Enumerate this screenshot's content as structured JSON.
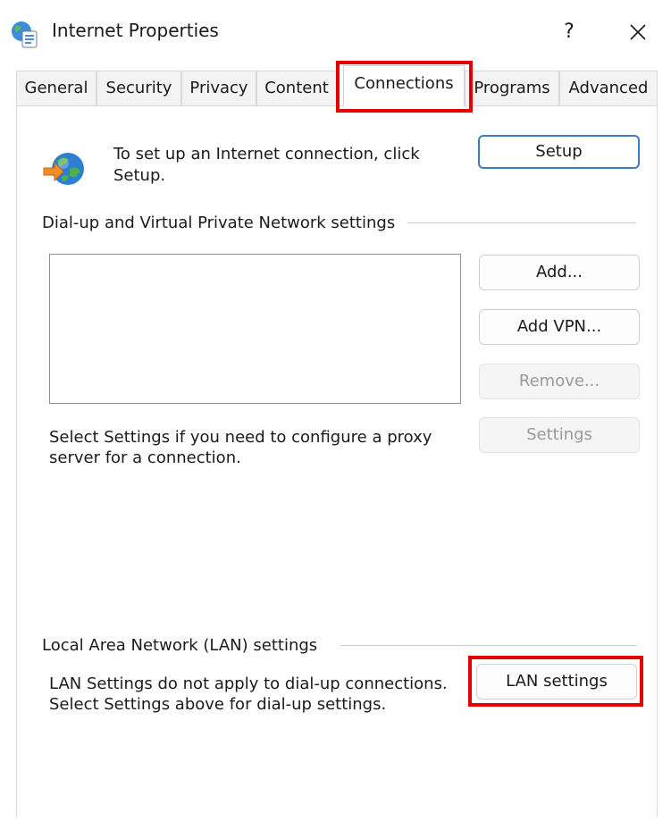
{
  "window": {
    "title": "Internet Properties",
    "help_label": "?",
    "close_icon": "close-icon",
    "app_icon": "internet-properties-icon"
  },
  "tabs": [
    {
      "label": "General",
      "active": false
    },
    {
      "label": "Security",
      "active": false
    },
    {
      "label": "Privacy",
      "active": false
    },
    {
      "label": "Content",
      "active": false
    },
    {
      "label": "Connections",
      "active": true
    },
    {
      "label": "Programs",
      "active": false
    },
    {
      "label": "Advanced",
      "active": false
    }
  ],
  "setup_section": {
    "icon": "globe-connection-icon",
    "text_line1": "To set up an Internet connection, click",
    "text_line2": "Setup.",
    "button": "Setup"
  },
  "dialup_section": {
    "group_label": "Dial-up and Virtual Private Network settings",
    "connections": [],
    "buttons": {
      "add": "Add...",
      "add_vpn": "Add VPN...",
      "remove": "Remove...",
      "settings": "Settings"
    },
    "proxy_text_line1": "Select Settings if you need to configure a proxy",
    "proxy_text_line2": "server for a connection."
  },
  "lan_section": {
    "group_label": "Local Area Network (LAN) settings",
    "text_line1": "LAN Settings do not apply to dial-up connections.",
    "text_line2": "Select Settings above for dial-up settings.",
    "button": "LAN settings"
  },
  "colors": {
    "highlight": "#e60000",
    "primary_border": "#3b7dbf",
    "disabled_text": "#9a9a9a"
  }
}
